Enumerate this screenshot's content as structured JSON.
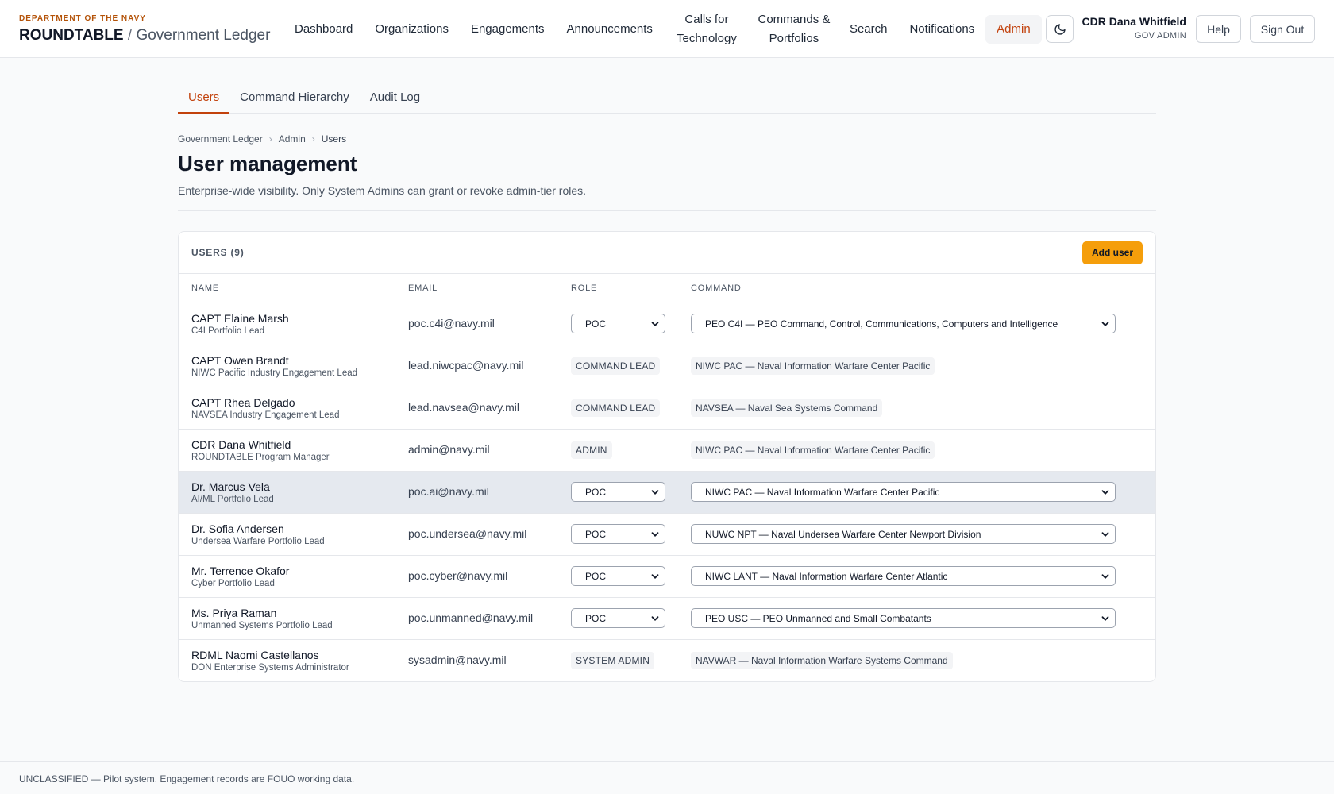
{
  "brand": {
    "department": "DEPARTMENT OF THE NAVY",
    "app_name": "ROUNDTABLE",
    "separator": "/",
    "sub_name": "Government Ledger"
  },
  "nav": [
    {
      "label": "Dashboard"
    },
    {
      "label": "Organizations"
    },
    {
      "label": "Engagements"
    },
    {
      "label": "Announcements"
    },
    {
      "label": "Calls for Technology"
    },
    {
      "label": "Commands & Portfolios"
    },
    {
      "label": "Search"
    },
    {
      "label": "Notifications"
    },
    {
      "label": "Admin",
      "active": true
    }
  ],
  "header": {
    "theme_icon": "moon-icon",
    "user_name": "CDR Dana Whitfield",
    "user_role": "GOV ADMIN",
    "help_label": "Help",
    "signout_label": "Sign Out"
  },
  "subtabs": [
    {
      "label": "Users",
      "active": true
    },
    {
      "label": "Command Hierarchy"
    },
    {
      "label": "Audit Log"
    }
  ],
  "breadcrumb": [
    "Government Ledger",
    "Admin",
    "Users"
  ],
  "page": {
    "title": "User management",
    "description": "Enterprise-wide visibility. Only System Admins can grant or revoke admin-tier roles."
  },
  "users_card": {
    "title": "USERS (9)",
    "add_label": "Add user",
    "columns": [
      "NAME",
      "EMAIL",
      "ROLE",
      "COMMAND"
    ],
    "rows": [
      {
        "name": "CAPT Elaine Marsh",
        "title": "C4I Portfolio Lead",
        "email": "poc.c4i@navy.mil",
        "role": "POC",
        "command": "PEO C4I — PEO Command, Control, Communications, Computers and Intelligence"
      },
      {
        "name": "CAPT Owen Brandt",
        "title": "NIWC Pacific Industry Engagement Lead",
        "email": "lead.niwcpac@navy.mil",
        "role": "COMMAND LEAD",
        "command": "NIWC PAC — Naval Information Warfare Center Pacific"
      },
      {
        "name": "CAPT Rhea Delgado",
        "title": "NAVSEA Industry Engagement Lead",
        "email": "lead.navsea@navy.mil",
        "role": "COMMAND LEAD",
        "command": "NAVSEA — Naval Sea Systems Command"
      },
      {
        "name": "CDR Dana Whitfield",
        "title": "ROUNDTABLE Program Manager",
        "email": "admin@navy.mil",
        "role": "ADMIN",
        "command": "NIWC PAC — Naval Information Warfare Center Pacific"
      },
      {
        "name": "Dr. Marcus Vela",
        "title": "AI/ML Portfolio Lead",
        "email": "poc.ai@navy.mil",
        "role": "POC",
        "command": "NIWC PAC — Naval Information Warfare Center Pacific"
      },
      {
        "name": "Dr. Sofia Andersen",
        "title": "Undersea Warfare Portfolio Lead",
        "email": "poc.undersea@navy.mil",
        "role": "POC",
        "command": "NUWC NPT — Naval Undersea Warfare Center Newport Division"
      },
      {
        "name": "Mr. Terrence Okafor",
        "title": "Cyber Portfolio Lead",
        "email": "poc.cyber@navy.mil",
        "role": "POC",
        "command": "NIWC LANT — Naval Information Warfare Center Atlantic"
      },
      {
        "name": "Ms. Priya Raman",
        "title": "Unmanned Systems Portfolio Lead",
        "email": "poc.unmanned@navy.mil",
        "role": "POC",
        "command": "PEO USC — PEO Unmanned and Small Combatants"
      },
      {
        "name": "RDML Naomi Castellanos",
        "title": "DON Enterprise Systems Administrator",
        "email": "sysadmin@navy.mil",
        "role": "SYSTEM ADMIN",
        "command": "NAVWAR — Naval Information Warfare Systems Command"
      }
    ]
  },
  "footer": {
    "text": "UNCLASSIFIED — Pilot system. Engagement records are FOUO working data."
  },
  "colors": {
    "accent": "#c2410c",
    "add_button": "#f59e0b",
    "highlight_row": "#e5e9ef"
  }
}
